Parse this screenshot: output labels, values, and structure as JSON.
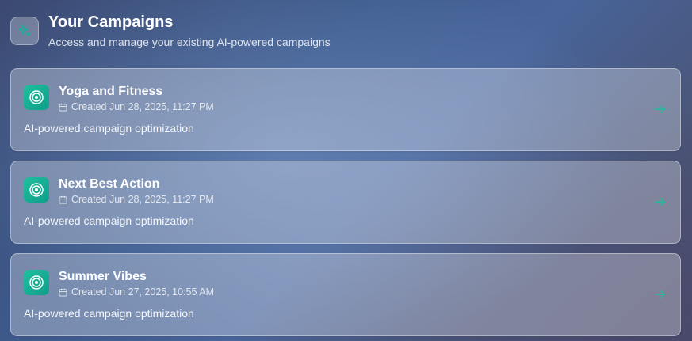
{
  "header": {
    "icon": "sparkles-icon",
    "title": "Your Campaigns",
    "subtitle": "Access and manage your existing AI-powered campaigns"
  },
  "campaigns": [
    {
      "name": "Yoga and Fitness",
      "created": "Created Jun 28, 2025, 11:27 PM",
      "description": "AI-powered campaign optimization"
    },
    {
      "name": "Next Best Action",
      "created": "Created Jun 28, 2025, 11:27 PM",
      "description": "AI-powered campaign optimization"
    },
    {
      "name": "Summer Vibes",
      "created": "Created Jun 27, 2025, 10:55 AM",
      "description": "AI-powered campaign optimization"
    }
  ],
  "colors": {
    "accent": "#14b896",
    "arrow": "#2bb79a"
  }
}
